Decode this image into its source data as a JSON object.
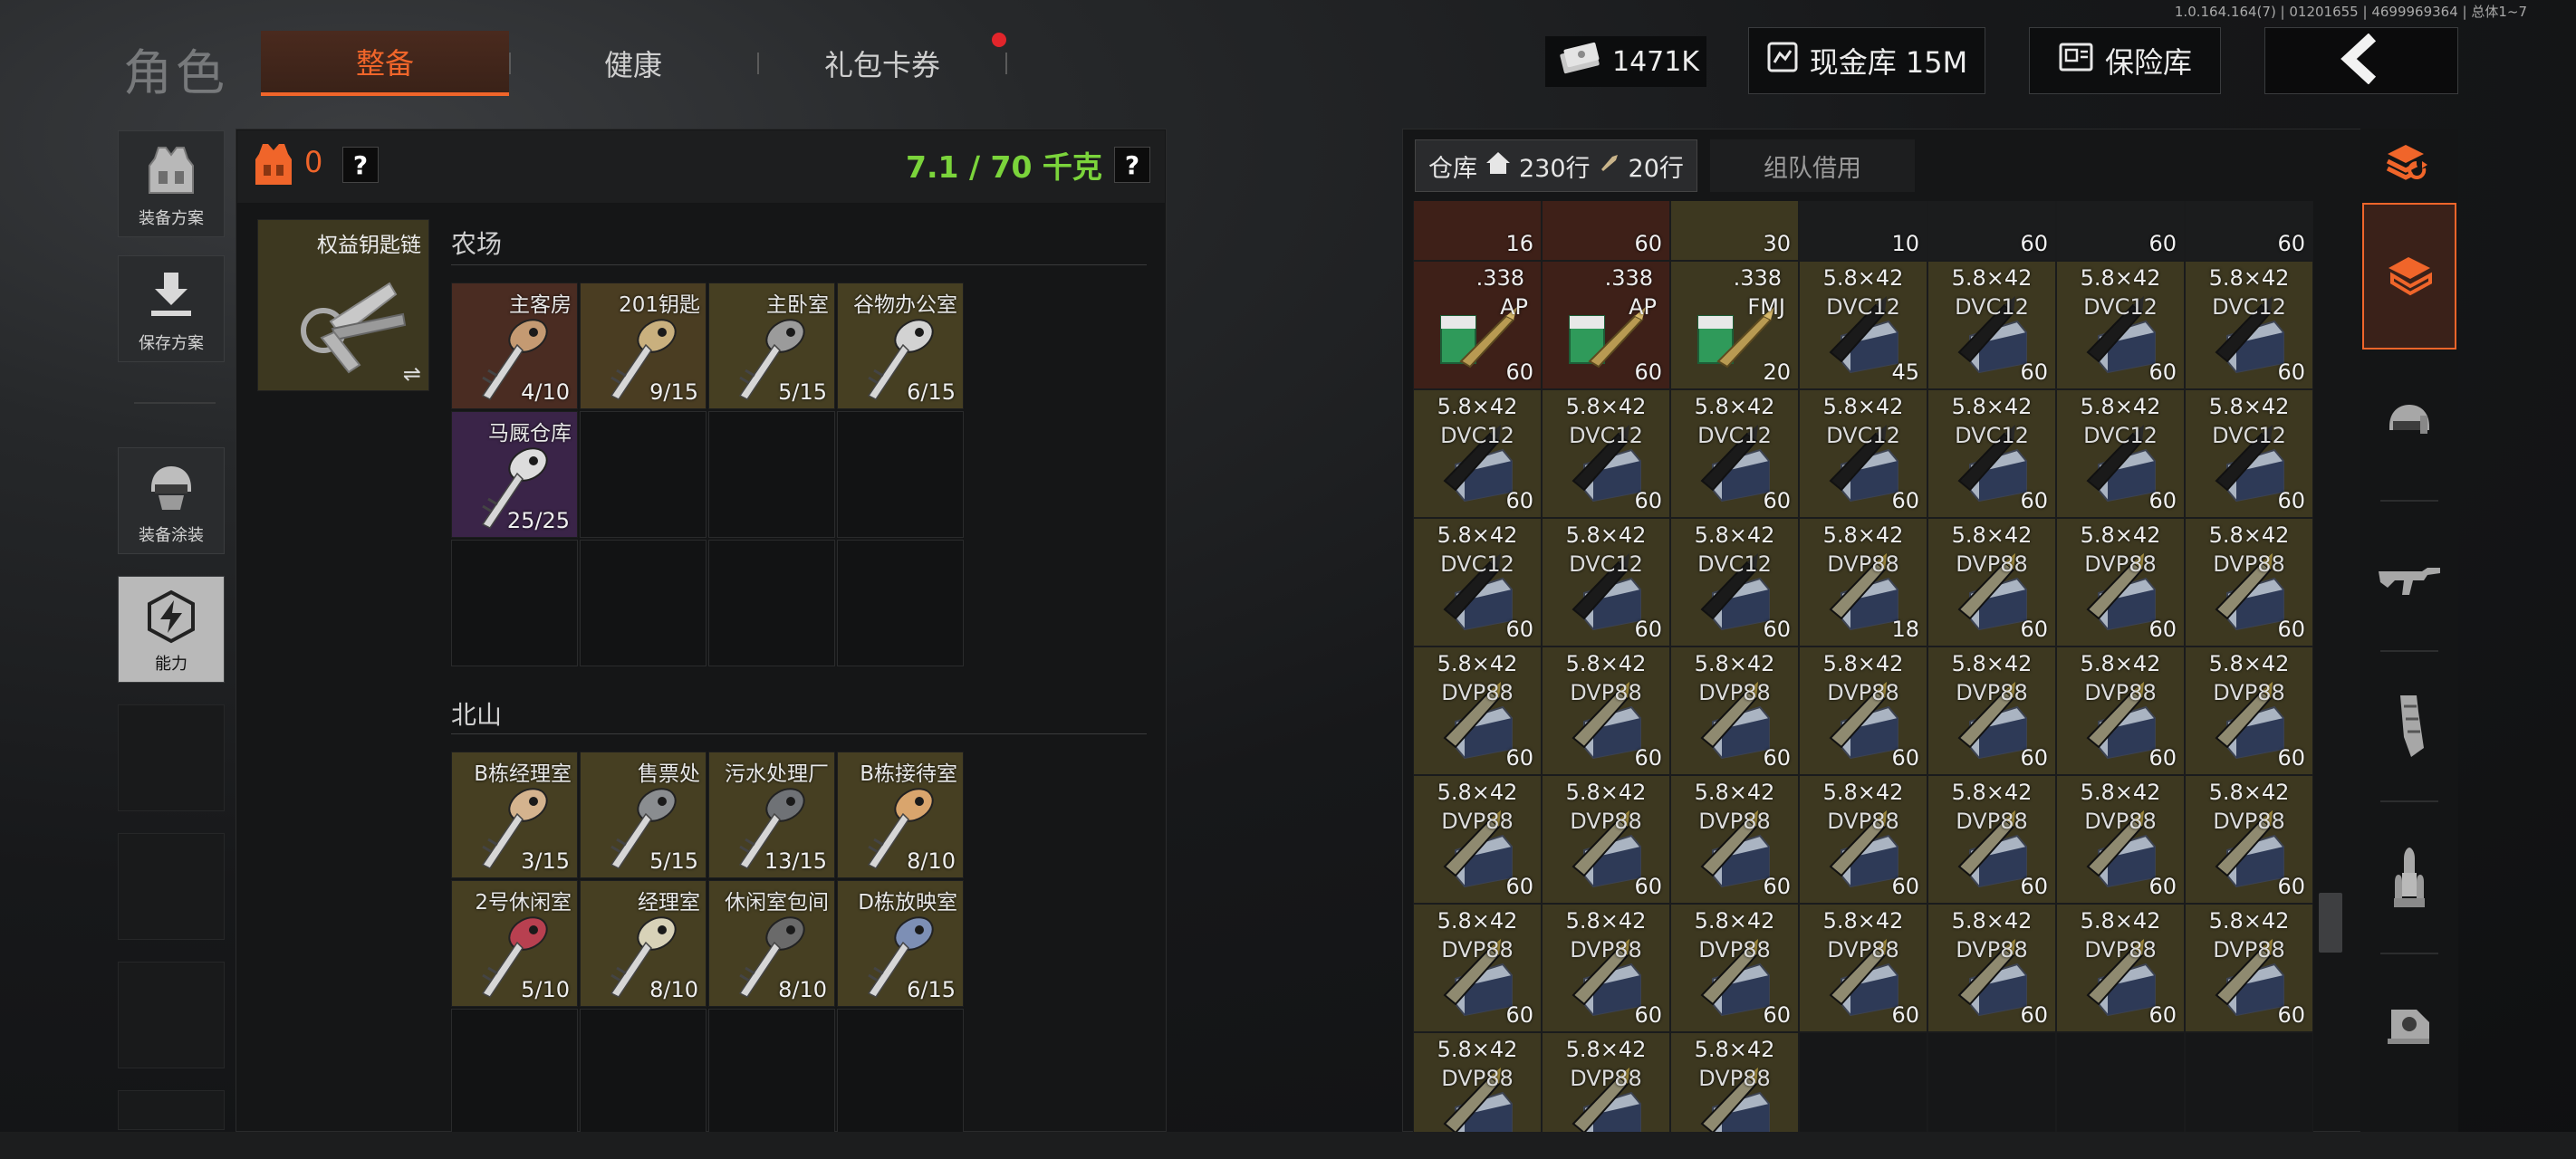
{
  "version": "1.0.164.164(7) | 01201655 | 4699969364 | 总体1~7",
  "title": "角色",
  "tabs": [
    {
      "label": "整备",
      "active": true
    },
    {
      "label": "健康",
      "active": false
    },
    {
      "label": "礼包卡券",
      "active": false,
      "notify": true
    }
  ],
  "money": {
    "value": "1471K",
    "icon": "cash-icon"
  },
  "cash_vault": {
    "label": "现金库 15M",
    "icon": "vault-icon"
  },
  "insurance": {
    "label": "保险库",
    "icon": "insurance-icon"
  },
  "back_icon": "chevron-left-icon",
  "sidebar": [
    {
      "label": "装备方案",
      "icon": "vest-icon"
    },
    {
      "label": "保存方案",
      "icon": "download-icon"
    },
    {
      "label": "装备涂装",
      "icon": "helmet-icon"
    },
    {
      "label": "能力",
      "icon": "lightning-icon",
      "active": true
    }
  ],
  "loadout": {
    "armor_count": "0",
    "weight": "7.1 / 70 千克",
    "help": "?",
    "keychain_name": "权益钥匙链",
    "swap_icon": "⇌"
  },
  "key_sections": [
    {
      "label": "农场",
      "keys": [
        {
          "name": "主客房",
          "count": "4/10",
          "bg": "#4a2c22",
          "key": "#c49a72"
        },
        {
          "name": "201钥匙",
          "count": "9/15",
          "bg": "#4a3d22",
          "key": "#c9b07e"
        },
        {
          "name": "主卧室",
          "count": "5/15",
          "bg": "#463f22",
          "key": "#9b9b9b"
        },
        {
          "name": "谷物办公室",
          "count": "6/15",
          "bg": "#463f22",
          "key": "#d2d2d2"
        },
        {
          "name": "马厩仓库",
          "count": "25/25",
          "bg": "#3a2448",
          "key": "#dcdcdc"
        }
      ]
    },
    {
      "label": "北山",
      "keys": [
        {
          "name": "B栋经理室",
          "count": "3/15",
          "bg": "#463f22",
          "key": "#d4b38e"
        },
        {
          "name": "售票处",
          "count": "5/15",
          "bg": "#463f22",
          "key": "#8a8d90"
        },
        {
          "name": "污水处理厂",
          "count": "13/15",
          "bg": "#463f22",
          "key": "#6f7276"
        },
        {
          "name": "B栋接待室",
          "count": "8/10",
          "bg": "#463f22",
          "key": "#d9a56d"
        },
        {
          "name": "2号休闲室",
          "count": "5/10",
          "bg": "#463f22",
          "key": "#b84050"
        },
        {
          "name": "经理室",
          "count": "8/10",
          "bg": "#463f22",
          "key": "#d8d2b8"
        },
        {
          "name": "休闲室包间",
          "count": "8/10",
          "bg": "#463f22",
          "key": "#6a6a6a"
        },
        {
          "name": "D栋放映室",
          "count": "6/15",
          "bg": "#463f22",
          "key": "#7d8fb5"
        }
      ]
    }
  ],
  "stash": {
    "tab_label": "仓库",
    "rows_label": "230行",
    "ammo_label": "20行",
    "team_tab": "组队借用",
    "top_row": [
      "16",
      "60",
      "30",
      "10",
      "60",
      "60",
      "60"
    ],
    "items": [
      {
        "l1": ".338",
        "l2": "AP",
        "count": "60",
        "type": "338"
      },
      {
        "l1": ".338",
        "l2": "AP",
        "count": "60",
        "type": "338"
      },
      {
        "l1": ".338",
        "l2": "FMJ",
        "count": "20",
        "type": "338"
      },
      {
        "l1": "5.8×42",
        "l2": "DVC12",
        "count": "45",
        "type": "dvc"
      },
      {
        "l1": "5.8×42",
        "l2": "DVC12",
        "count": "60",
        "type": "dvc"
      },
      {
        "l1": "5.8×42",
        "l2": "DVC12",
        "count": "60",
        "type": "dvc"
      },
      {
        "l1": "5.8×42",
        "l2": "DVC12",
        "count": "60",
        "type": "dvc"
      },
      {
        "l1": "5.8×42",
        "l2": "DVC12",
        "count": "60",
        "type": "dvc"
      },
      {
        "l1": "5.8×42",
        "l2": "DVC12",
        "count": "60",
        "type": "dvc"
      },
      {
        "l1": "5.8×42",
        "l2": "DVC12",
        "count": "60",
        "type": "dvc"
      },
      {
        "l1": "5.8×42",
        "l2": "DVC12",
        "count": "60",
        "type": "dvc"
      },
      {
        "l1": "5.8×42",
        "l2": "DVC12",
        "count": "60",
        "type": "dvc"
      },
      {
        "l1": "5.8×42",
        "l2": "DVC12",
        "count": "60",
        "type": "dvc"
      },
      {
        "l1": "5.8×42",
        "l2": "DVC12",
        "count": "60",
        "type": "dvc"
      },
      {
        "l1": "5.8×42",
        "l2": "DVC12",
        "count": "60",
        "type": "dvc"
      },
      {
        "l1": "5.8×42",
        "l2": "DVC12",
        "count": "60",
        "type": "dvc"
      },
      {
        "l1": "5.8×42",
        "l2": "DVC12",
        "count": "60",
        "type": "dvc"
      },
      {
        "l1": "5.8×42",
        "l2": "DVP88",
        "count": "18",
        "type": "dvp"
      },
      {
        "l1": "5.8×42",
        "l2": "DVP88",
        "count": "60",
        "type": "dvp"
      },
      {
        "l1": "5.8×42",
        "l2": "DVP88",
        "count": "60",
        "type": "dvp"
      },
      {
        "l1": "5.8×42",
        "l2": "DVP88",
        "count": "60",
        "type": "dvp"
      },
      {
        "l1": "5.8×42",
        "l2": "DVP88",
        "count": "60",
        "type": "dvp"
      },
      {
        "l1": "5.8×42",
        "l2": "DVP88",
        "count": "60",
        "type": "dvp"
      },
      {
        "l1": "5.8×42",
        "l2": "DVP88",
        "count": "60",
        "type": "dvp"
      },
      {
        "l1": "5.8×42",
        "l2": "DVP88",
        "count": "60",
        "type": "dvp"
      },
      {
        "l1": "5.8×42",
        "l2": "DVP88",
        "count": "60",
        "type": "dvp"
      },
      {
        "l1": "5.8×42",
        "l2": "DVP88",
        "count": "60",
        "type": "dvp"
      },
      {
        "l1": "5.8×42",
        "l2": "DVP88",
        "count": "60",
        "type": "dvp"
      },
      {
        "l1": "5.8×42",
        "l2": "DVP88",
        "count": "60",
        "type": "dvp"
      },
      {
        "l1": "5.8×42",
        "l2": "DVP88",
        "count": "60",
        "type": "dvp"
      },
      {
        "l1": "5.8×42",
        "l2": "DVP88",
        "count": "60",
        "type": "dvp"
      },
      {
        "l1": "5.8×42",
        "l2": "DVP88",
        "count": "60",
        "type": "dvp"
      },
      {
        "l1": "5.8×42",
        "l2": "DVP88",
        "count": "60",
        "type": "dvp"
      },
      {
        "l1": "5.8×42",
        "l2": "DVP88",
        "count": "60",
        "type": "dvp"
      },
      {
        "l1": "5.8×42",
        "l2": "DVP88",
        "count": "60",
        "type": "dvp"
      },
      {
        "l1": "5.8×42",
        "l2": "DVP88",
        "count": "60",
        "type": "dvp"
      },
      {
        "l1": "5.8×42",
        "l2": "DVP88",
        "count": "60",
        "type": "dvp"
      },
      {
        "l1": "5.8×42",
        "l2": "DVP88",
        "count": "60",
        "type": "dvp"
      },
      {
        "l1": "5.8×42",
        "l2": "DVP88",
        "count": "60",
        "type": "dvp"
      },
      {
        "l1": "5.8×42",
        "l2": "DVP88",
        "count": "60",
        "type": "dvp"
      },
      {
        "l1": "5.8×42",
        "l2": "DVP88",
        "count": "60",
        "type": "dvp"
      },
      {
        "l1": "5.8×42",
        "l2": "DVP88",
        "count": "60",
        "type": "dvp"
      },
      {
        "l1": "5.8×42",
        "l2": "DVP88",
        "count": "",
        "type": "dvp"
      },
      {
        "l1": "5.8×42",
        "l2": "DVP88",
        "count": "",
        "type": "dvp"
      },
      {
        "l1": "5.8×42",
        "l2": "DVP88",
        "count": "",
        "type": "dvp"
      }
    ]
  },
  "categories": [
    {
      "icon": "stack-refresh-icon"
    },
    {
      "icon": "storage-box-icon",
      "active": true
    },
    {
      "icon": "helmet-icon"
    },
    {
      "icon": "rifle-icon"
    },
    {
      "icon": "magazine-icon"
    },
    {
      "icon": "bullet-icon"
    },
    {
      "icon": "scope-icon"
    }
  ],
  "colors": {
    "accent": "#f0652a",
    "weight": "#7bd43b",
    "gold_cell": "#3d3820",
    "red_cell": "#3e2018"
  }
}
